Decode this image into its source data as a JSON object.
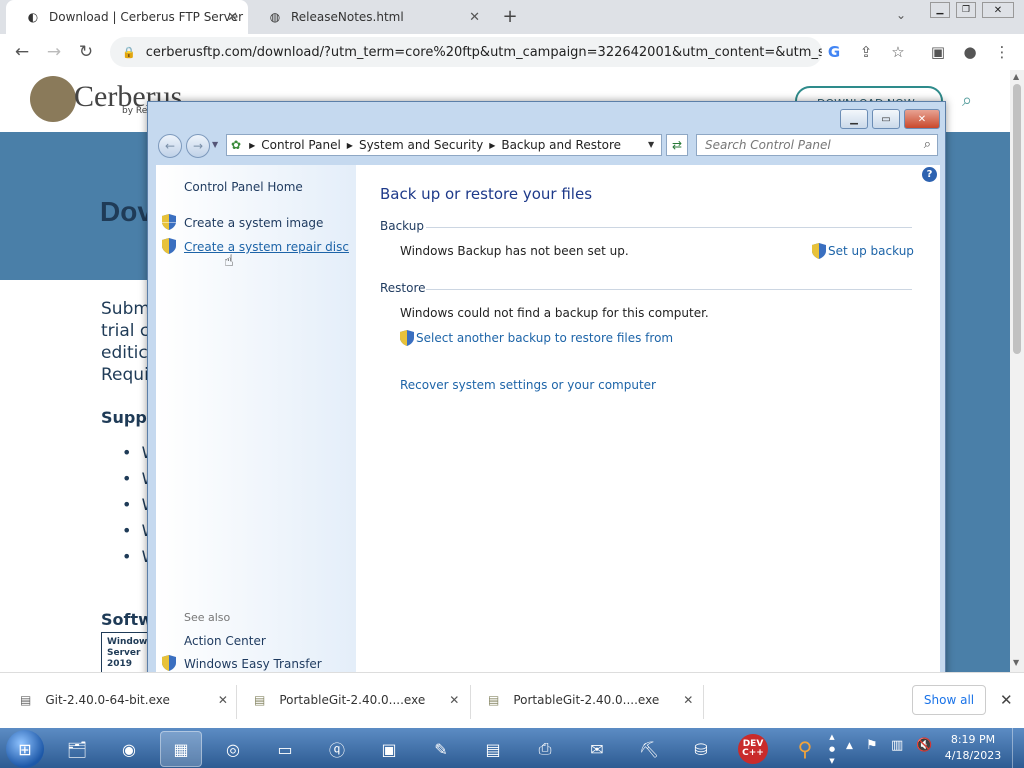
{
  "browser": {
    "tabs": [
      {
        "title": "Download | Cerberus FTP Server",
        "active": true
      },
      {
        "title": "ReleaseNotes.html",
        "active": false
      }
    ],
    "new_tab": "+",
    "url": "cerberusftp.com/download/?utm_term=core%20ftp&utm_campaign=322642001&utm_content=&utm_sou..."
  },
  "page": {
    "logo_text": "Cerberus",
    "logo_sub": "by Re",
    "download_btn": "DOWNLOAD NOW",
    "heading": "Dov",
    "para": [
      "Subm",
      "trial c",
      "editic"
    ],
    "requirements": "Requir",
    "support": "Suppo",
    "bullets": [
      "W",
      "W",
      "W",
      "W",
      "W"
    ],
    "software": "Softw",
    "card_lines": [
      "Windows",
      "Server",
      "2019"
    ]
  },
  "cp": {
    "address": [
      "Control Panel",
      "System and Security",
      "Backup and Restore"
    ],
    "search_placeholder": "Search Control Panel",
    "left": {
      "home": "Control Panel Home",
      "links": [
        "Create a system image",
        "Create a system repair disc"
      ],
      "see_also": "See also",
      "see_links": [
        "Action Center",
        "Windows Easy Transfer"
      ]
    },
    "main": {
      "title": "Back up or restore your files",
      "backup_head": "Backup",
      "backup_text": "Windows Backup has not been set up.",
      "setup_link": "Set up backup",
      "restore_head": "Restore",
      "restore_text": "Windows could not find a backup for this computer.",
      "select_link": "Select another backup to restore files from",
      "recover_link": "Recover system settings or your computer"
    }
  },
  "downloads": {
    "items": [
      "Git-2.40.0-64-bit.exe",
      "PortableGit-2.40.0....exe",
      "PortableGit-2.40.0....exe"
    ],
    "show_all": "Show all"
  },
  "taskbar": {
    "time": "8:19 PM",
    "date": "4/18/2023"
  }
}
